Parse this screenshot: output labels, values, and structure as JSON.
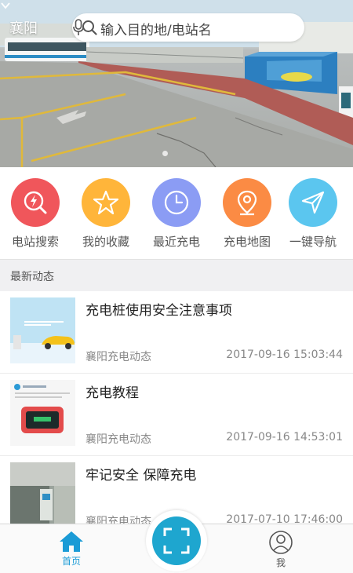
{
  "header": {
    "city": "襄阳",
    "search_placeholder": "输入目的地/电站名"
  },
  "quick_menu": [
    {
      "label": "电站搜索",
      "icon": "station-search-icon",
      "color": "#f0565b"
    },
    {
      "label": "我的收藏",
      "icon": "star-icon",
      "color": "#ffb53a"
    },
    {
      "label": "最近充电",
      "icon": "clock-icon",
      "color": "#8b9cf4"
    },
    {
      "label": "充电地图",
      "icon": "map-pin-icon",
      "color": "#fb8b44"
    },
    {
      "label": "一键导航",
      "icon": "navigation-icon",
      "color": "#5bc6ef"
    }
  ],
  "news": {
    "section_title": "最新动态",
    "items": [
      {
        "title": "充电桩使用安全注意事项",
        "source": "襄阳充电动态",
        "time": "2017-09-16 15:03:44"
      },
      {
        "title": "充电教程",
        "source": "襄阳充电动态",
        "time": "2017-09-16 14:53:01"
      },
      {
        "title": "牢记安全  保障充电",
        "source": "襄阳充电动态",
        "time": "2017-07-10 17:46:00"
      }
    ]
  },
  "tabbar": {
    "home_label": "首页",
    "me_label": "我",
    "accent": "#1b9bd6"
  }
}
